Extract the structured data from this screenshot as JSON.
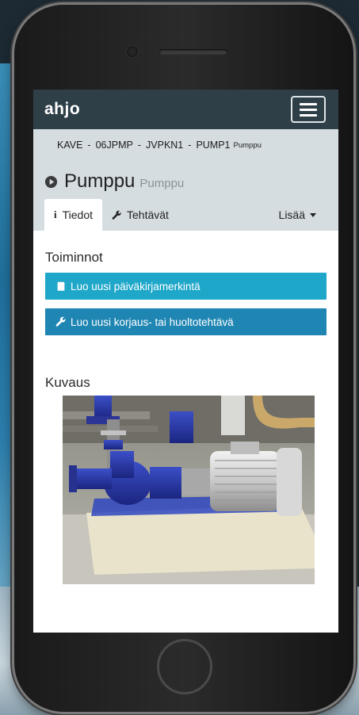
{
  "app": {
    "brand": "ahjo"
  },
  "breadcrumb": {
    "items": [
      "KAVE",
      "06JPMP",
      "JVPKN1",
      "PUMP1"
    ],
    "separator": "-",
    "suffix": "Pumppu"
  },
  "page": {
    "title": "Pumppu",
    "subtitle": "Pumppu"
  },
  "tabs": [
    {
      "label": "Tiedot",
      "icon": "info-icon"
    },
    {
      "label": "Tehtävät",
      "icon": "wrench-icon"
    }
  ],
  "more_tab": {
    "label": "Lisää",
    "icon": "caret-down-icon"
  },
  "actions": {
    "heading": "Toiminnot",
    "buttons": [
      {
        "label": "Luo uusi päiväkirjamerkintä",
        "icon": "book-icon",
        "color": "#1ea7c9"
      },
      {
        "label": "Luo uusi korjaus- tai huoltotehtävä",
        "icon": "wrench-icon",
        "color": "#1f86b3"
      }
    ]
  },
  "description": {
    "heading": "Kuvaus"
  },
  "colors": {
    "navbar": "#2f3f48",
    "subnav": "#d5dde1"
  }
}
